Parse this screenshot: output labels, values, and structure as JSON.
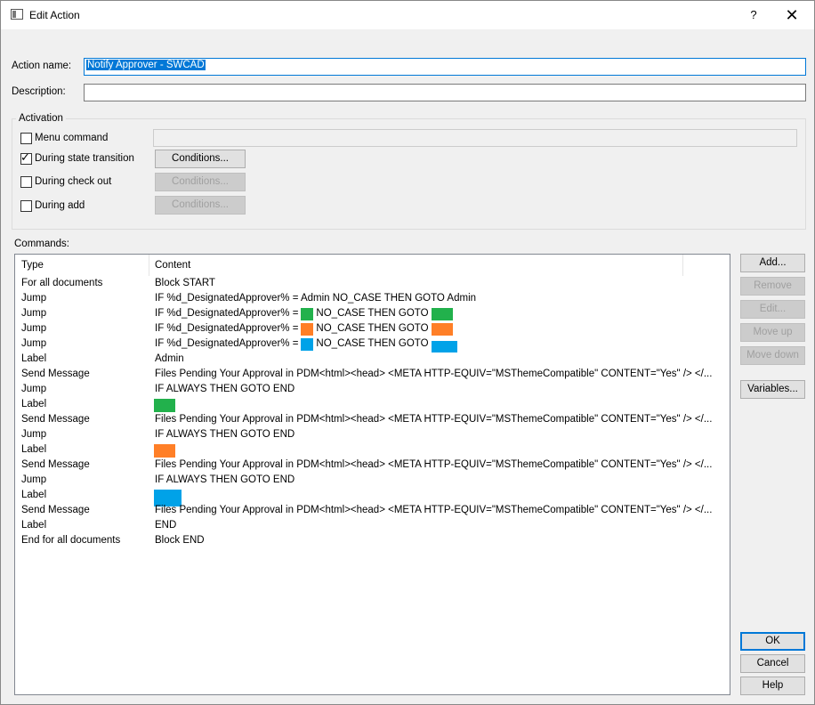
{
  "window": {
    "title": "Edit Action",
    "help_glyph": "?",
    "close_glyph": "✕"
  },
  "form": {
    "action_name_label": "Action name:",
    "action_name_value": "Notify Approver - SWCAD",
    "description_label": "Description:",
    "description_value": ""
  },
  "activation": {
    "title": "Activation",
    "menu_command": {
      "label": "Menu command",
      "checked": false,
      "value": ""
    },
    "during_state_transition": {
      "label": "During state transition",
      "checked": true,
      "button": "Conditions..."
    },
    "during_check_out": {
      "label": "During check out",
      "checked": false,
      "button": "Conditions..."
    },
    "during_add": {
      "label": "During add",
      "checked": false,
      "button": "Conditions..."
    }
  },
  "commands": {
    "label": "Commands:",
    "columns": [
      "Type",
      "Content"
    ],
    "swatch_colors": {
      "green": "#22b14c",
      "orange": "#ff7f27",
      "blue": "#00a2e8"
    },
    "rows": [
      {
        "type": "For all documents",
        "content": [
          {
            "text": "Block START"
          }
        ]
      },
      {
        "type": "Jump",
        "content": [
          {
            "text": "IF %d_DesignatedApprover% = Admin NO_CASE THEN GOTO Admin"
          }
        ]
      },
      {
        "type": "Jump",
        "content": [
          {
            "text": "IF %d_DesignatedApprover% ="
          },
          {
            "swatch": "green"
          },
          {
            "text": "NO_CASE THEN GOTO"
          },
          {
            "swatch": "green"
          }
        ]
      },
      {
        "type": "Jump",
        "content": [
          {
            "text": "IF %d_DesignatedApprover% ="
          },
          {
            "swatch": "orange"
          },
          {
            "text": "NO_CASE THEN GOTO"
          },
          {
            "swatch": "orange"
          }
        ]
      },
      {
        "type": "Jump",
        "content": [
          {
            "text": "IF %d_DesignatedApprover% ="
          },
          {
            "swatch": "blue"
          },
          {
            "text": "NO_CASE THEN GOTO"
          },
          {
            "swatch": "blue"
          }
        ]
      },
      {
        "type": "Label",
        "content": [
          {
            "text": "Admin"
          }
        ]
      },
      {
        "type": "Send Message",
        "content": [
          {
            "text": "Files Pending Your Approval in PDM<html><head> <META HTTP-EQUIV=\"MSThemeCompatible\" CONTENT=\"Yes\" /> </..."
          }
        ]
      },
      {
        "type": "Jump",
        "content": [
          {
            "text": "IF  ALWAYS  THEN GOTO END"
          }
        ]
      },
      {
        "type": "Label",
        "content": [
          {
            "swatch": "green"
          }
        ]
      },
      {
        "type": "Send Message",
        "content": [
          {
            "text": "Files Pending Your Approval in PDM<html><head> <META HTTP-EQUIV=\"MSThemeCompatible\" CONTENT=\"Yes\" /> </..."
          }
        ]
      },
      {
        "type": "Jump",
        "content": [
          {
            "text": "IF  ALWAYS  THEN GOTO END"
          }
        ]
      },
      {
        "type": "Label",
        "content": [
          {
            "swatch": "orange"
          }
        ]
      },
      {
        "type": "Send Message",
        "content": [
          {
            "text": "Files Pending Your Approval in PDM<html><head> <META HTTP-EQUIV=\"MSThemeCompatible\" CONTENT=\"Yes\" /> </..."
          }
        ]
      },
      {
        "type": "Jump",
        "content": [
          {
            "text": "IF  ALWAYS  THEN GOTO END"
          }
        ]
      },
      {
        "type": "Label",
        "content": [
          {
            "swatch": "blue"
          }
        ]
      },
      {
        "type": "Send Message",
        "content": [
          {
            "text": "Files Pending Your Approval in PDM<html><head> <META HTTP-EQUIV=\"MSThemeCompatible\" CONTENT=\"Yes\" /> </..."
          }
        ]
      },
      {
        "type": "Label",
        "content": [
          {
            "text": "END"
          }
        ]
      },
      {
        "type": "End for all documents",
        "content": [
          {
            "text": "Block END"
          }
        ]
      }
    ]
  },
  "side_buttons": {
    "add": "Add...",
    "remove": "Remove",
    "edit": "Edit...",
    "move_up": "Move up",
    "move_down": "Move down",
    "variables": "Variables..."
  },
  "footer_buttons": {
    "ok": "OK",
    "cancel": "Cancel",
    "help": "Help"
  }
}
